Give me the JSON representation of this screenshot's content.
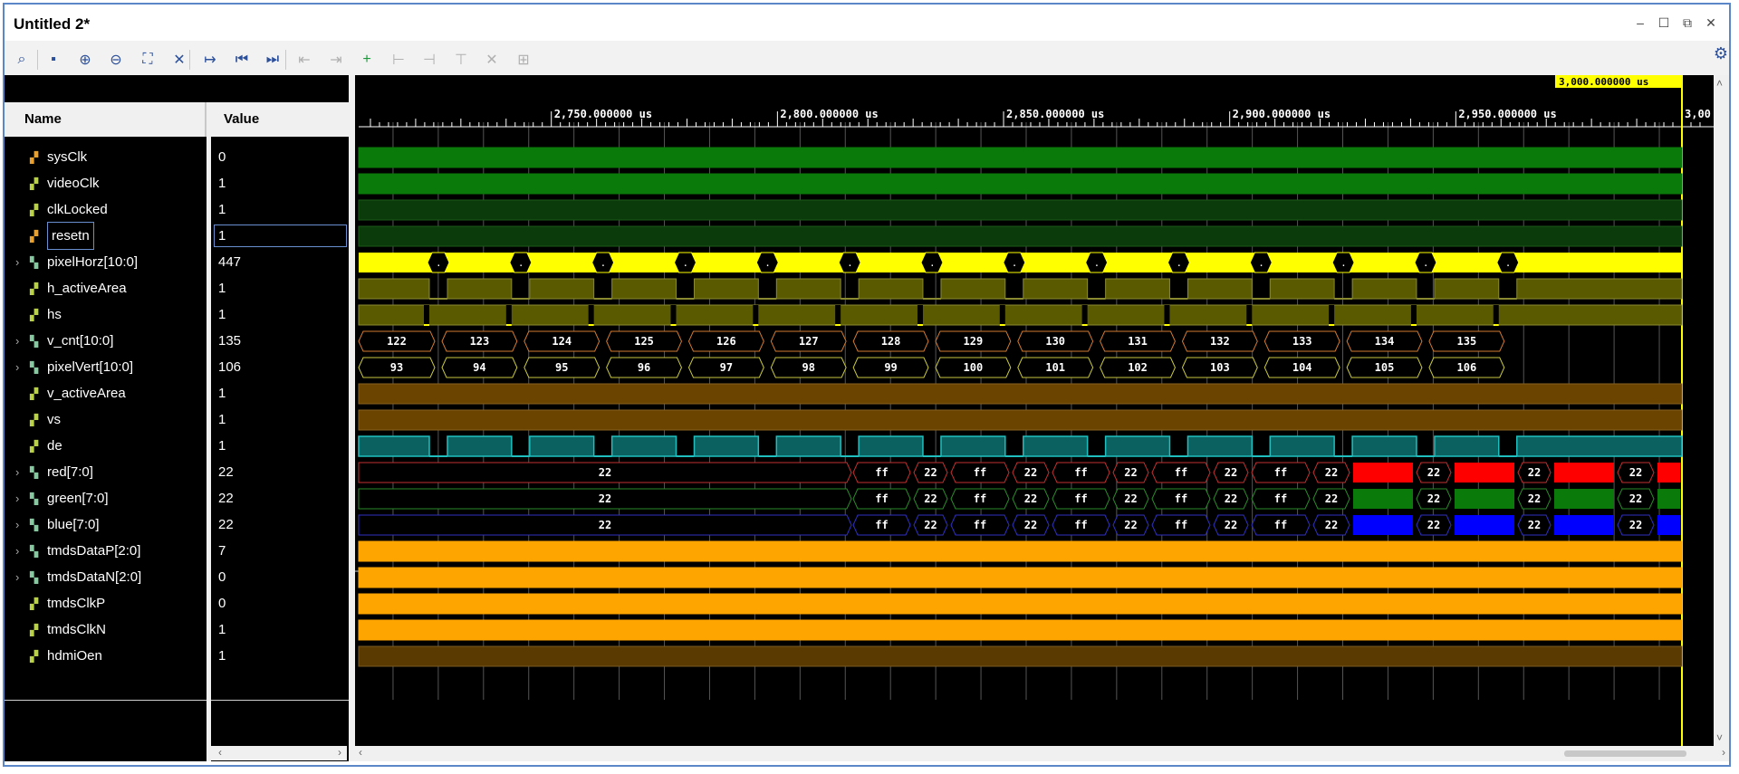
{
  "window": {
    "title": "Untitled 2*"
  },
  "toolbar": {
    "buttons": [
      {
        "name": "search-icon",
        "glyph": "⌕"
      },
      {
        "name": "save-icon",
        "glyph": "▪"
      },
      {
        "name": "zoom-in-icon",
        "glyph": "⊕"
      },
      {
        "name": "zoom-out-icon",
        "glyph": "⊖"
      },
      {
        "name": "zoom-fit-icon",
        "glyph": "⛶"
      },
      {
        "name": "cursor-to-zoom-icon",
        "glyph": "✕"
      },
      {
        "name": "goto-cursor-icon",
        "glyph": "↦"
      },
      {
        "name": "goto-time-zero-icon",
        "glyph": "⏮"
      },
      {
        "name": "goto-last-time-icon",
        "glyph": "⏭"
      },
      {
        "name": "previous-transition-icon",
        "glyph": "⇤"
      },
      {
        "name": "next-transition-icon",
        "glyph": "⇥"
      },
      {
        "name": "add-marker-icon",
        "glyph": "+"
      },
      {
        "name": "previous-marker-icon",
        "glyph": "⊢"
      },
      {
        "name": "next-marker-icon",
        "glyph": "⊣"
      },
      {
        "name": "swap-cursors-icon",
        "glyph": "⊤"
      },
      {
        "name": "delete-marker-icon",
        "glyph": "✕"
      },
      {
        "name": "snap-icon",
        "glyph": "⊞"
      }
    ]
  },
  "columns": {
    "name": "Name",
    "value": "Value"
  },
  "signals": [
    {
      "name": "sysClk",
      "value": "0",
      "bus": false,
      "kind": "in"
    },
    {
      "name": "videoClk",
      "value": "1",
      "bus": false,
      "kind": "sig"
    },
    {
      "name": "clkLocked",
      "value": "1",
      "bus": false,
      "kind": "sig"
    },
    {
      "name": "resetn",
      "value": "1",
      "bus": false,
      "kind": "in"
    },
    {
      "name": "pixelHorz[10:0]",
      "value": "447",
      "bus": true,
      "kind": "bus"
    },
    {
      "name": "h_activeArea",
      "value": "1",
      "bus": false,
      "kind": "sig"
    },
    {
      "name": "hs",
      "value": "1",
      "bus": false,
      "kind": "sig"
    },
    {
      "name": "v_cnt[10:0]",
      "value": "135",
      "bus": true,
      "kind": "bus"
    },
    {
      "name": "pixelVert[10:0]",
      "value": "106",
      "bus": true,
      "kind": "bus"
    },
    {
      "name": "v_activeArea",
      "value": "1",
      "bus": false,
      "kind": "sig"
    },
    {
      "name": "vs",
      "value": "1",
      "bus": false,
      "kind": "sig"
    },
    {
      "name": "de",
      "value": "1",
      "bus": false,
      "kind": "sig"
    },
    {
      "name": "red[7:0]",
      "value": "22",
      "bus": true,
      "kind": "bus"
    },
    {
      "name": "green[7:0]",
      "value": "22",
      "bus": true,
      "kind": "bus"
    },
    {
      "name": "blue[7:0]",
      "value": "22",
      "bus": true,
      "kind": "bus"
    },
    {
      "name": "tmdsDataP[2:0]",
      "value": "7",
      "bus": true,
      "kind": "bus"
    },
    {
      "name": "tmdsDataN[2:0]",
      "value": "0",
      "bus": true,
      "kind": "bus"
    },
    {
      "name": "tmdsClkP",
      "value": "0",
      "bus": false,
      "kind": "sig"
    },
    {
      "name": "tmdsClkN",
      "value": "1",
      "bus": false,
      "kind": "sig"
    },
    {
      "name": "hdmiOen",
      "value": "1",
      "bus": false,
      "kind": "sig"
    }
  ],
  "timeline": {
    "cursor_label": "3,000.000000 us",
    "ticks": [
      "2,750.000000 us",
      "2,800.000000 us",
      "2,850.000000 us",
      "2,900.000000 us",
      "2,950.000000 us",
      "3,00"
    ]
  },
  "bus_values": {
    "pixelHorz": ".",
    "v_cnt": [
      "122",
      "123",
      "124",
      "125",
      "126",
      "127",
      "128",
      "129",
      "130",
      "131",
      "132",
      "133",
      "134",
      "135"
    ],
    "pixelVert": [
      "93",
      "94",
      "95",
      "96",
      "97",
      "98",
      "99",
      "100",
      "101",
      "102",
      "103",
      "104",
      "105",
      "106"
    ],
    "rgb_first": "22",
    "rgb_alt": [
      "ff",
      "22"
    ]
  },
  "colors": {
    "clk": "#0a7a0a",
    "dim": "#0b3a0b",
    "yellow": "#ffff00",
    "olive": "#5a5a00",
    "brown": "#6b4500",
    "cyan": "#1fbfbf",
    "orange": "#ffa500",
    "red": "#ff0000",
    "green": "#0a7a0a",
    "blue": "#0000ff"
  }
}
